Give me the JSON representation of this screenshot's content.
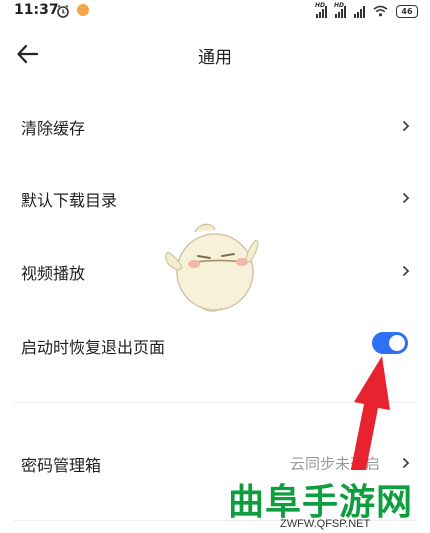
{
  "status_bar": {
    "time": "11:37",
    "battery": "46",
    "icons": [
      "alarm-icon",
      "notification-badge-icon",
      "signal-hd-icon",
      "signal-hd-icon",
      "signal-icon",
      "wifi-icon",
      "battery-icon"
    ]
  },
  "header": {
    "title": "通用",
    "back_icon": "back-arrow-icon"
  },
  "settings": {
    "items": [
      {
        "label": "清除缓存",
        "icon": "chevron-right-icon"
      },
      {
        "label": "默认下载目录",
        "icon": "chevron-right-icon"
      },
      {
        "label": "视频播放",
        "icon": "chevron-right-icon"
      },
      {
        "label": "启动时恢复退出页面",
        "toggle_on": true
      },
      {
        "label": "密码管理箱",
        "value": "云同步未开启",
        "icon": "chevron-right-icon"
      }
    ]
  },
  "watermark": {
    "title": "曲阜手游网",
    "url": "ZWFW.QFSP.NET"
  },
  "colors": {
    "toggle_on": "#2d6ff5",
    "annotation_arrow": "#e8232f",
    "watermark_green": "#0f9e3f"
  }
}
